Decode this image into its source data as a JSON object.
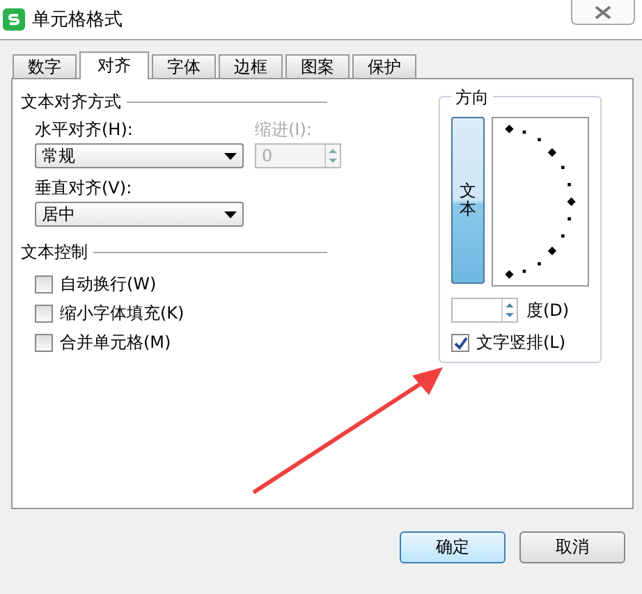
{
  "window": {
    "title": "单元格格式"
  },
  "tabs": [
    {
      "label": "数字",
      "selected": false
    },
    {
      "label": "对齐",
      "selected": true
    },
    {
      "label": "字体",
      "selected": false
    },
    {
      "label": "边框",
      "selected": false
    },
    {
      "label": "图案",
      "selected": false
    },
    {
      "label": "保护",
      "selected": false
    }
  ],
  "alignment": {
    "heading": "文本对齐方式",
    "horizontal": {
      "label": "水平对齐(H):",
      "value": "常规"
    },
    "indent": {
      "label": "缩进(I):",
      "value": "0",
      "disabled": true
    },
    "vertical": {
      "label": "垂直对齐(V):",
      "value": "居中"
    }
  },
  "text_control": {
    "heading": "文本控制",
    "options": [
      {
        "label": "自动换行(W)",
        "checked": false
      },
      {
        "label": "缩小字体填充(K)",
        "checked": false
      },
      {
        "label": "合并单元格(M)",
        "checked": false
      }
    ]
  },
  "orientation": {
    "heading": "方向",
    "vertical_button": {
      "label": "文本",
      "selected": true
    },
    "degree_label": "度(D)",
    "vertical_text": {
      "label": "文字竖排(L)",
      "checked": true
    }
  },
  "buttons": [
    {
      "label": "确定",
      "primary": true
    },
    {
      "label": "取消",
      "primary": false
    }
  ]
}
